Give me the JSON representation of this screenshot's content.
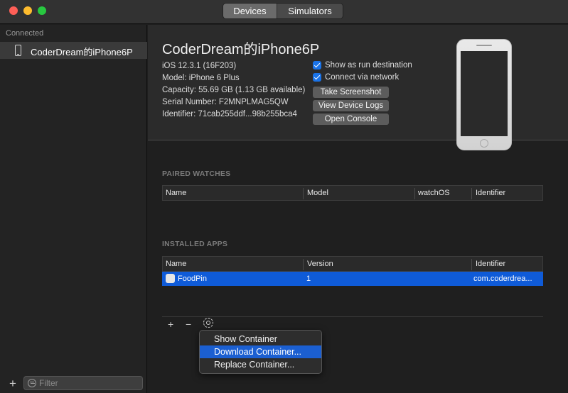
{
  "window": {
    "tabs": [
      "Devices",
      "Simulators"
    ],
    "active_tab": "Devices"
  },
  "sidebar": {
    "header": "Connected",
    "items": [
      {
        "label": "CoderDream的iPhone6P",
        "icon": "iphone-icon"
      }
    ],
    "add_label": "+",
    "filter_placeholder": "Filter"
  },
  "device": {
    "name": "CoderDream的iPhone6P",
    "info": [
      "iOS 12.3.1 (16F203)",
      "Model: iPhone 6 Plus",
      "Capacity: 55.69 GB (1.13 GB available)",
      "Serial Number: F2MNPLMAG5QW",
      "Identifier: 71cab255ddf...98b255bca4"
    ],
    "checkboxes": [
      {
        "label": "Show as run destination",
        "checked": true
      },
      {
        "label": "Connect via network",
        "checked": true
      }
    ],
    "buttons": [
      "Take Screenshot",
      "View Device Logs",
      "Open Console"
    ]
  },
  "paired_watches": {
    "title": "PAIRED WATCHES",
    "columns": [
      "Name",
      "Model",
      "watchOS",
      "Identifier"
    ],
    "rows": []
  },
  "installed_apps": {
    "title": "INSTALLED APPS",
    "columns": [
      "Name",
      "Version",
      "Identifier"
    ],
    "rows": [
      {
        "name": "FoodPin",
        "version": "1",
        "identifier": "com.coderdrea..."
      }
    ]
  },
  "toolbar": {
    "add": "+",
    "remove": "−"
  },
  "context_menu": {
    "items": [
      "Show Container",
      "Download Container...",
      "Replace Container..."
    ],
    "highlighted": "Download Container..."
  },
  "colors": {
    "accent": "#0f5bd8",
    "menu_highlight": "#1b5fd1"
  }
}
